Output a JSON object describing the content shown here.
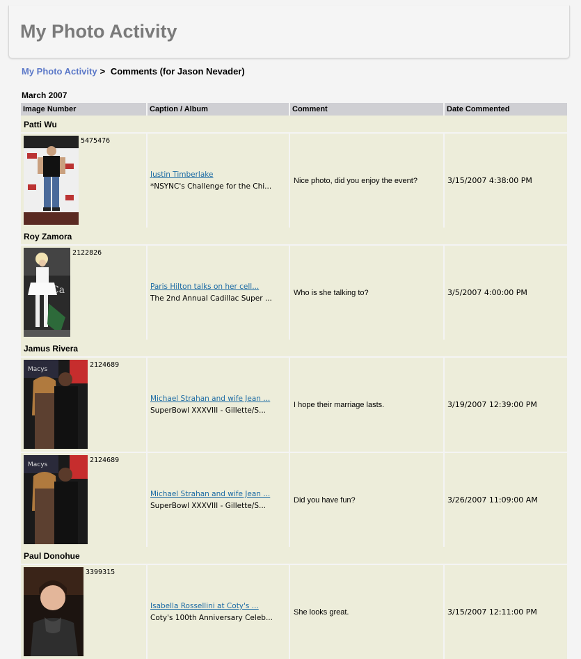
{
  "page": {
    "title": "My Photo Activity"
  },
  "breadcrumb": {
    "link": "My Photo Activity",
    "separator": ">",
    "current": "Comments (for Jason Nevader)"
  },
  "month": "March 2007",
  "columns": [
    "Image Number",
    "Caption / Album",
    "Comment",
    "Date Commented"
  ],
  "groups": [
    {
      "user": "Patti Wu",
      "items": [
        {
          "image_number": "5475476",
          "caption": "Justin Timberlake",
          "album": "*NSYNC's Challenge for the Chi...",
          "comment": "Nice photo, did you enjoy the event?",
          "date": "3/15/2007 4:38:00 PM"
        }
      ]
    },
    {
      "user": "Roy Zamora",
      "items": [
        {
          "image_number": "2122826",
          "caption": "Paris Hilton talks on her cell...",
          "album": "The 2nd Annual Cadillac Super ...",
          "comment": "Who is she talking to?",
          "date": "3/5/2007 4:00:00 PM"
        }
      ]
    },
    {
      "user": "Jamus Rivera",
      "items": [
        {
          "image_number": "2124689",
          "caption": "Michael Strahan and wife Jean ...",
          "album": "SuperBowl XXXVIII - Gillette/S...",
          "comment": "I hope their marriage lasts.",
          "date": "3/19/2007 12:39:00 PM"
        },
        {
          "image_number": "2124689",
          "caption": "Michael Strahan and wife Jean ...",
          "album": "SuperBowl XXXVIII - Gillette/S...",
          "comment": "Did you have fun?",
          "date": "3/26/2007 11:09:00 AM"
        }
      ]
    },
    {
      "user": "Paul Donohue",
      "items": [
        {
          "image_number": "3399315",
          "caption": "Isabella Rossellini at Coty's ...",
          "album": "Coty's 100th Anniversary Celeb...",
          "comment": "She looks great.",
          "date": "3/15/2007 12:11:00 PM"
        }
      ]
    }
  ]
}
